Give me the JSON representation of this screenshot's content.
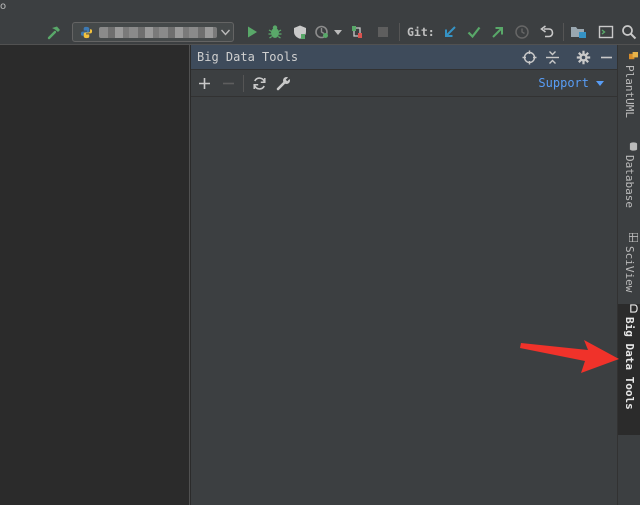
{
  "window": {
    "title_fragment": "o"
  },
  "toolbar": {
    "build_icon": "hammer-icon",
    "run_config": {
      "icon": "python-icon",
      "value": "",
      "dropdown_icon": "chevron-down-icon"
    },
    "actions": [
      {
        "name": "run",
        "icon": "run-triangle-icon",
        "color": "#59a869"
      },
      {
        "name": "debug",
        "icon": "bug-icon",
        "color": "#59a869"
      },
      {
        "name": "coverage",
        "icon": "shield-icon"
      },
      {
        "name": "profile",
        "icon": "profile-icon"
      },
      {
        "name": "attach",
        "icon": "attach-icon"
      },
      {
        "name": "stop",
        "icon": "stop-icon"
      }
    ],
    "git_label": "Git:",
    "git_actions": [
      {
        "name": "update",
        "icon": "arrow-down-left-icon",
        "color": "#3592c4"
      },
      {
        "name": "commit",
        "icon": "checkmark-icon",
        "color": "#59a869"
      },
      {
        "name": "push",
        "icon": "arrow-up-right-icon",
        "color": "#59a869"
      },
      {
        "name": "history",
        "icon": "clock-icon"
      },
      {
        "name": "rollback",
        "icon": "undo-icon"
      }
    ],
    "project_structure_icon": "folder-icon",
    "terminal_icon": "terminal-icon",
    "search_icon": "search-icon"
  },
  "panel": {
    "title": "Big Data Tools",
    "header_icons": [
      "crosshair-icon",
      "collapse-icon",
      "gear-icon",
      "minimize-icon"
    ],
    "toolbar_icons": [
      "plus-icon",
      "minus-icon",
      "refresh-icon",
      "wrench-icon"
    ],
    "support_label": "Support"
  },
  "right_tabs": [
    {
      "label": "PlantUML",
      "icon": "plantuml-icon"
    },
    {
      "label": "Database",
      "icon": "database-icon"
    },
    {
      "label": "SciView",
      "icon": "sciview-icon"
    },
    {
      "label": "Big Data Tools",
      "icon": "big-data-tools-icon",
      "active": true
    }
  ],
  "colors": {
    "accent": "#589df6",
    "annotation_arrow": "#f0322a",
    "run_green": "#59a869",
    "git_blue": "#3592c4"
  }
}
